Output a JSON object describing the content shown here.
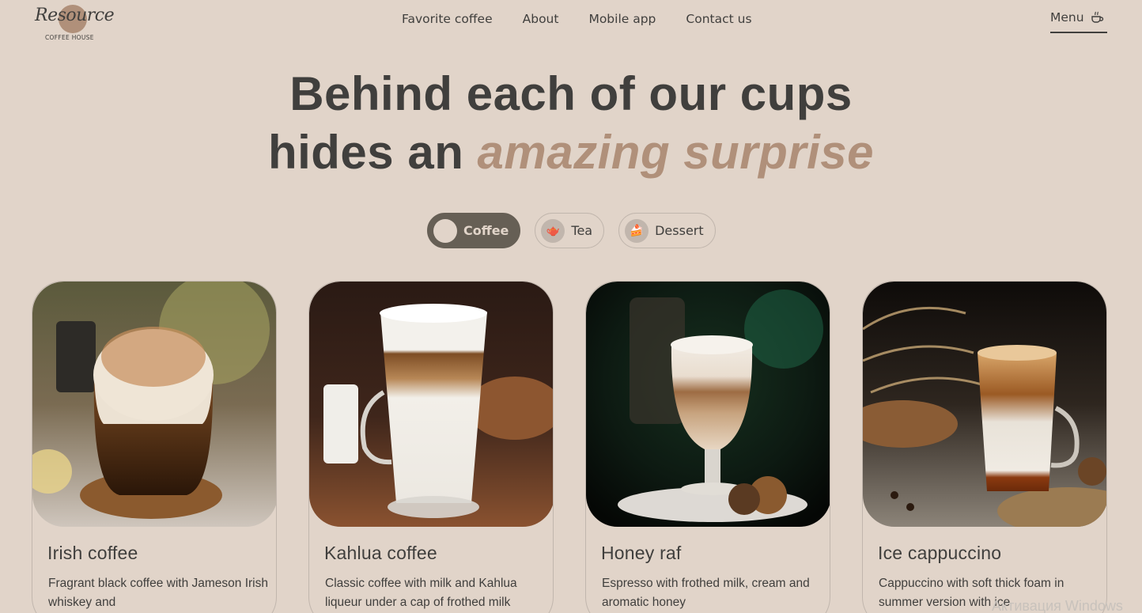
{
  "logo": {
    "word": "Resource",
    "sub": "COFFEE HOUSE"
  },
  "nav": [
    "Favorite coffee",
    "About",
    "Mobile app",
    "Contact us"
  ],
  "menu_label": "Menu",
  "hero": {
    "line1": "Behind each of our cups",
    "line2_prefix": "hides an ",
    "line2_accent": "amazing surprise"
  },
  "tabs": [
    {
      "label": "Coffee",
      "icon": "coffee-cup-icon",
      "active": true
    },
    {
      "label": "Tea",
      "icon": "teapot-icon",
      "active": false
    },
    {
      "label": "Dessert",
      "icon": "cake-icon",
      "active": false
    }
  ],
  "cards": [
    {
      "title": "Irish coffee",
      "desc": "Fragrant black coffee with Jameson Irish whiskey and"
    },
    {
      "title": "Kahlua coffee",
      "desc": "Classic coffee with milk and Kahlua liqueur under a cap of frothed milk"
    },
    {
      "title": "Honey raf",
      "desc": "Espresso with frothed milk, cream and aromatic honey"
    },
    {
      "title": "Ice cappuccino",
      "desc": "Cappuccino with soft thick foam in summer version with ice"
    }
  ],
  "watermark": "Активация Windows",
  "colors": {
    "background": "#e1d4c9",
    "text": "#403f3d",
    "accent": "#b0907a",
    "active_tab": "#665f55"
  }
}
